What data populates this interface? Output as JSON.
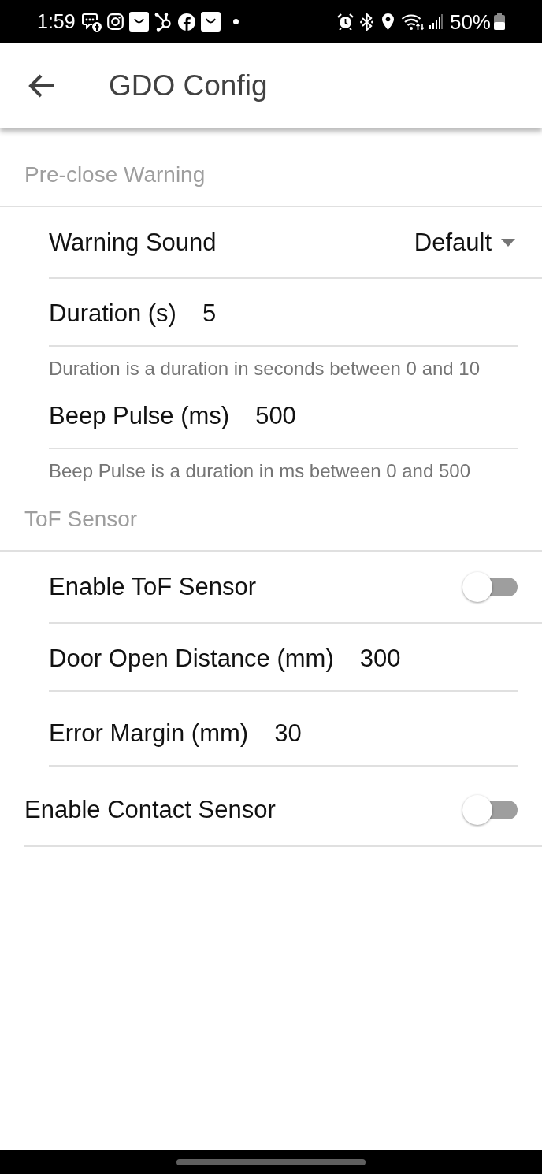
{
  "status_bar": {
    "time": "1:59",
    "battery": "50%"
  },
  "app_bar": {
    "title": "GDO Config"
  },
  "sections": [
    {
      "title": "Pre-close Warning",
      "items": [
        {
          "kind": "dropdown",
          "label": "Warning Sound",
          "value": "Default"
        },
        {
          "kind": "input",
          "label": "Duration (s)",
          "value": "5",
          "helper": "Duration is a duration in seconds between 0 and 10"
        },
        {
          "kind": "input",
          "label": "Beep Pulse (ms)",
          "value": "500",
          "helper": "Beep Pulse is a duration in ms between 0 and 500"
        }
      ]
    },
    {
      "title": "ToF Sensor",
      "items": [
        {
          "kind": "switch",
          "label": "Enable ToF Sensor",
          "on": false
        },
        {
          "kind": "input",
          "label": "Door Open Distance (mm)",
          "value": "300"
        },
        {
          "kind": "input",
          "label": "Error Margin (mm)",
          "value": "30"
        }
      ]
    }
  ],
  "ungrouped_items": [
    {
      "kind": "switch",
      "label": "Enable Contact Sensor",
      "on": false
    }
  ]
}
